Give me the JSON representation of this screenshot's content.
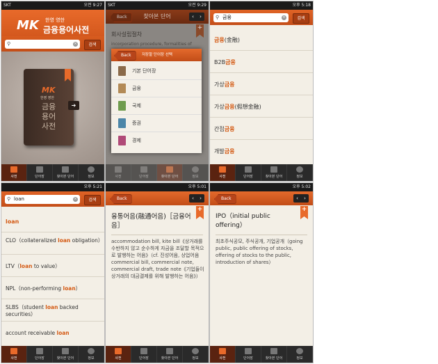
{
  "colors": {
    "accent": "#e86a2a",
    "tabbar": "#2a2a2a",
    "highlight": "#d45a14"
  },
  "screens": [
    {
      "status": {
        "left": "SKT",
        "right": "오전 9:27"
      },
      "logo": {
        "mk": "MK",
        "sub": "한영 영한",
        "title": "금융용어사전"
      },
      "search": {
        "value": "",
        "button": "검색"
      },
      "book": {
        "mk": "MK",
        "line1": "한영 영한",
        "line2": "금융",
        "line3": "용어",
        "line4": "사전"
      }
    },
    {
      "status": {
        "left": "SKT",
        "right": "오전 9:29"
      },
      "nav": {
        "back": "Back",
        "title": "찾아본 단어"
      },
      "bg": {
        "line1": "회사설립절차",
        "line2": "incorporation procedure, formalities of"
      },
      "modal": {
        "back": "Back",
        "title": "저장할 단어장 선택",
        "items": [
          {
            "label": "기본 단어장",
            "color": "#8a6a4a"
          },
          {
            "label": "금융",
            "color": "#b38a56"
          },
          {
            "label": "국제",
            "color": "#6f9c4e"
          },
          {
            "label": "증권",
            "color": "#4c86a8"
          },
          {
            "label": "경제",
            "color": "#b04a78"
          }
        ]
      }
    },
    {
      "status": {
        "left": "",
        "right": "오후 5:18"
      },
      "search": {
        "value": "금융",
        "button": "검색"
      },
      "rows": [
        {
          "pre": "",
          "hl": "금융",
          "post": "(金融)"
        },
        {
          "pre": "B2B",
          "hl": "금융",
          "post": ""
        },
        {
          "pre": "가상",
          "hl": "금융",
          "post": ""
        },
        {
          "pre": "가상",
          "hl": "금융",
          "post": "(假想金融)"
        },
        {
          "pre": "간접",
          "hl": "금융",
          "post": ""
        },
        {
          "pre": "개발",
          "hl": "금융",
          "post": ""
        }
      ]
    },
    {
      "status": {
        "left": "",
        "right": "오후 5:21"
      },
      "search": {
        "value": "loan",
        "button": "검색"
      },
      "rows": [
        {
          "pre": "",
          "hl": "loan",
          "post": ""
        },
        {
          "pre": "CLO（collateralized ",
          "hl": "loan",
          "post": " obligation）"
        },
        {
          "pre": "LTV（",
          "hl": "loan",
          "post": " to value）"
        },
        {
          "pre": "NPL（non-performing ",
          "hl": "loan",
          "post": "）"
        },
        {
          "pre": "SLBS（student ",
          "hl": "loan",
          "post": " backed securities）"
        },
        {
          "pre": "account receivable ",
          "hl": "loan",
          "post": ""
        }
      ]
    },
    {
      "status": {
        "left": "",
        "right": "오후 5:01"
      },
      "nav": {
        "back": "Back"
      },
      "title": "융통어음(融通어음)［금융어음］",
      "body": "accommodation bill, kite bill《상거래를 수반하지 않고 순수하게 자금을 조달할 목적으로 발행하는 어음》（cf. 진성어음, 상업어음 commercial bill, commercial note, commercial draft, trade note《기업들이 상거래의 대금결제를 위해 발행하는 어음》）"
    },
    {
      "status": {
        "left": "",
        "right": "오후 5:02"
      },
      "nav": {
        "back": "Back"
      },
      "title": "IPO（initial public offering）",
      "body": "최초주식공모, 주식공개, 기업공개（going public, public offering of stocks, offering of stocks to the public, introduction of shares）"
    }
  ],
  "tabs": [
    "사전",
    "단어장",
    "찾아본 단어",
    "정보"
  ]
}
